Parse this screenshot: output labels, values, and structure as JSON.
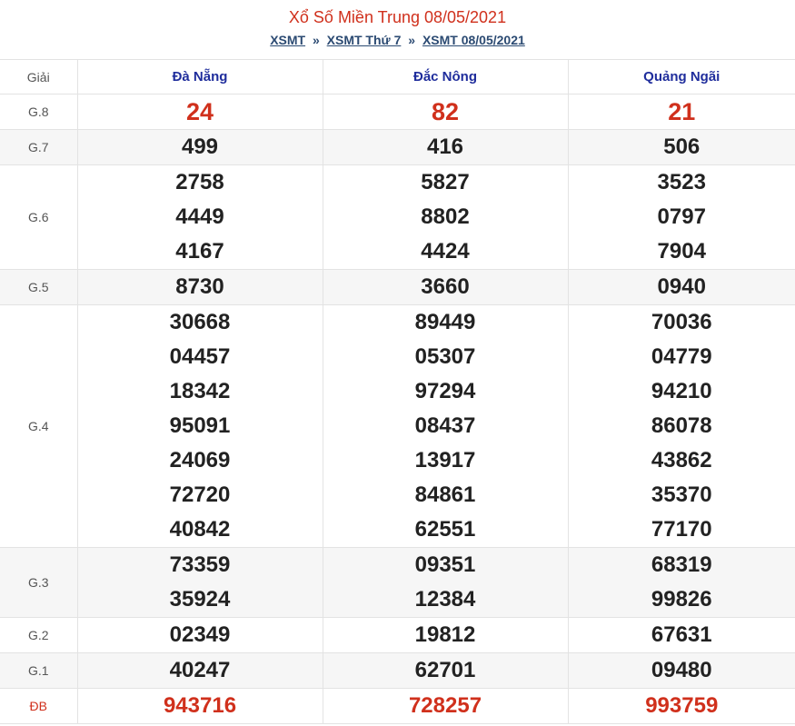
{
  "header": {
    "title": "Xổ Số Miền Trung 08/05/2021",
    "breadcrumb": [
      {
        "label": "XSMT"
      },
      {
        "label": "XSMT Thứ 7"
      },
      {
        "label": "XSMT 08/05/2021"
      }
    ],
    "separator": "»"
  },
  "table": {
    "prize_header": "Giải",
    "provinces": [
      "Đà Nẵng",
      "Đắc Nông",
      "Quảng Ngãi"
    ],
    "colors": {
      "accent_red": "#d0301c",
      "province_blue": "#1f2d9c",
      "link_blue": "#2b4a72"
    },
    "rows": [
      {
        "name": "G.8",
        "values": [
          [
            "24"
          ],
          [
            "82"
          ],
          [
            "21"
          ]
        ],
        "style": "red-big",
        "alt": false
      },
      {
        "name": "G.7",
        "values": [
          [
            "499"
          ],
          [
            "416"
          ],
          [
            "506"
          ]
        ],
        "style": "normal",
        "alt": true
      },
      {
        "name": "G.6",
        "values": [
          [
            "2758",
            "4449",
            "4167"
          ],
          [
            "5827",
            "8802",
            "4424"
          ],
          [
            "3523",
            "0797",
            "7904"
          ]
        ],
        "style": "normal",
        "alt": false
      },
      {
        "name": "G.5",
        "values": [
          [
            "8730"
          ],
          [
            "3660"
          ],
          [
            "0940"
          ]
        ],
        "style": "normal",
        "alt": true
      },
      {
        "name": "G.4",
        "values": [
          [
            "30668",
            "04457",
            "18342",
            "95091",
            "24069",
            "72720",
            "40842"
          ],
          [
            "89449",
            "05307",
            "97294",
            "08437",
            "13917",
            "84861",
            "62551"
          ],
          [
            "70036",
            "04779",
            "94210",
            "86078",
            "43862",
            "35370",
            "77170"
          ]
        ],
        "style": "normal",
        "alt": false
      },
      {
        "name": "G.3",
        "values": [
          [
            "73359",
            "35924"
          ],
          [
            "09351",
            "12384"
          ],
          [
            "68319",
            "99826"
          ]
        ],
        "style": "normal",
        "alt": true
      },
      {
        "name": "G.2",
        "values": [
          [
            "02349"
          ],
          [
            "19812"
          ],
          [
            "67631"
          ]
        ],
        "style": "normal",
        "alt": false
      },
      {
        "name": "G.1",
        "values": [
          [
            "40247"
          ],
          [
            "62701"
          ],
          [
            "09480"
          ]
        ],
        "style": "normal",
        "alt": true
      },
      {
        "name": "ĐB",
        "values": [
          [
            "943716"
          ],
          [
            "728257"
          ],
          [
            "993759"
          ]
        ],
        "style": "red",
        "alt": false
      }
    ]
  }
}
